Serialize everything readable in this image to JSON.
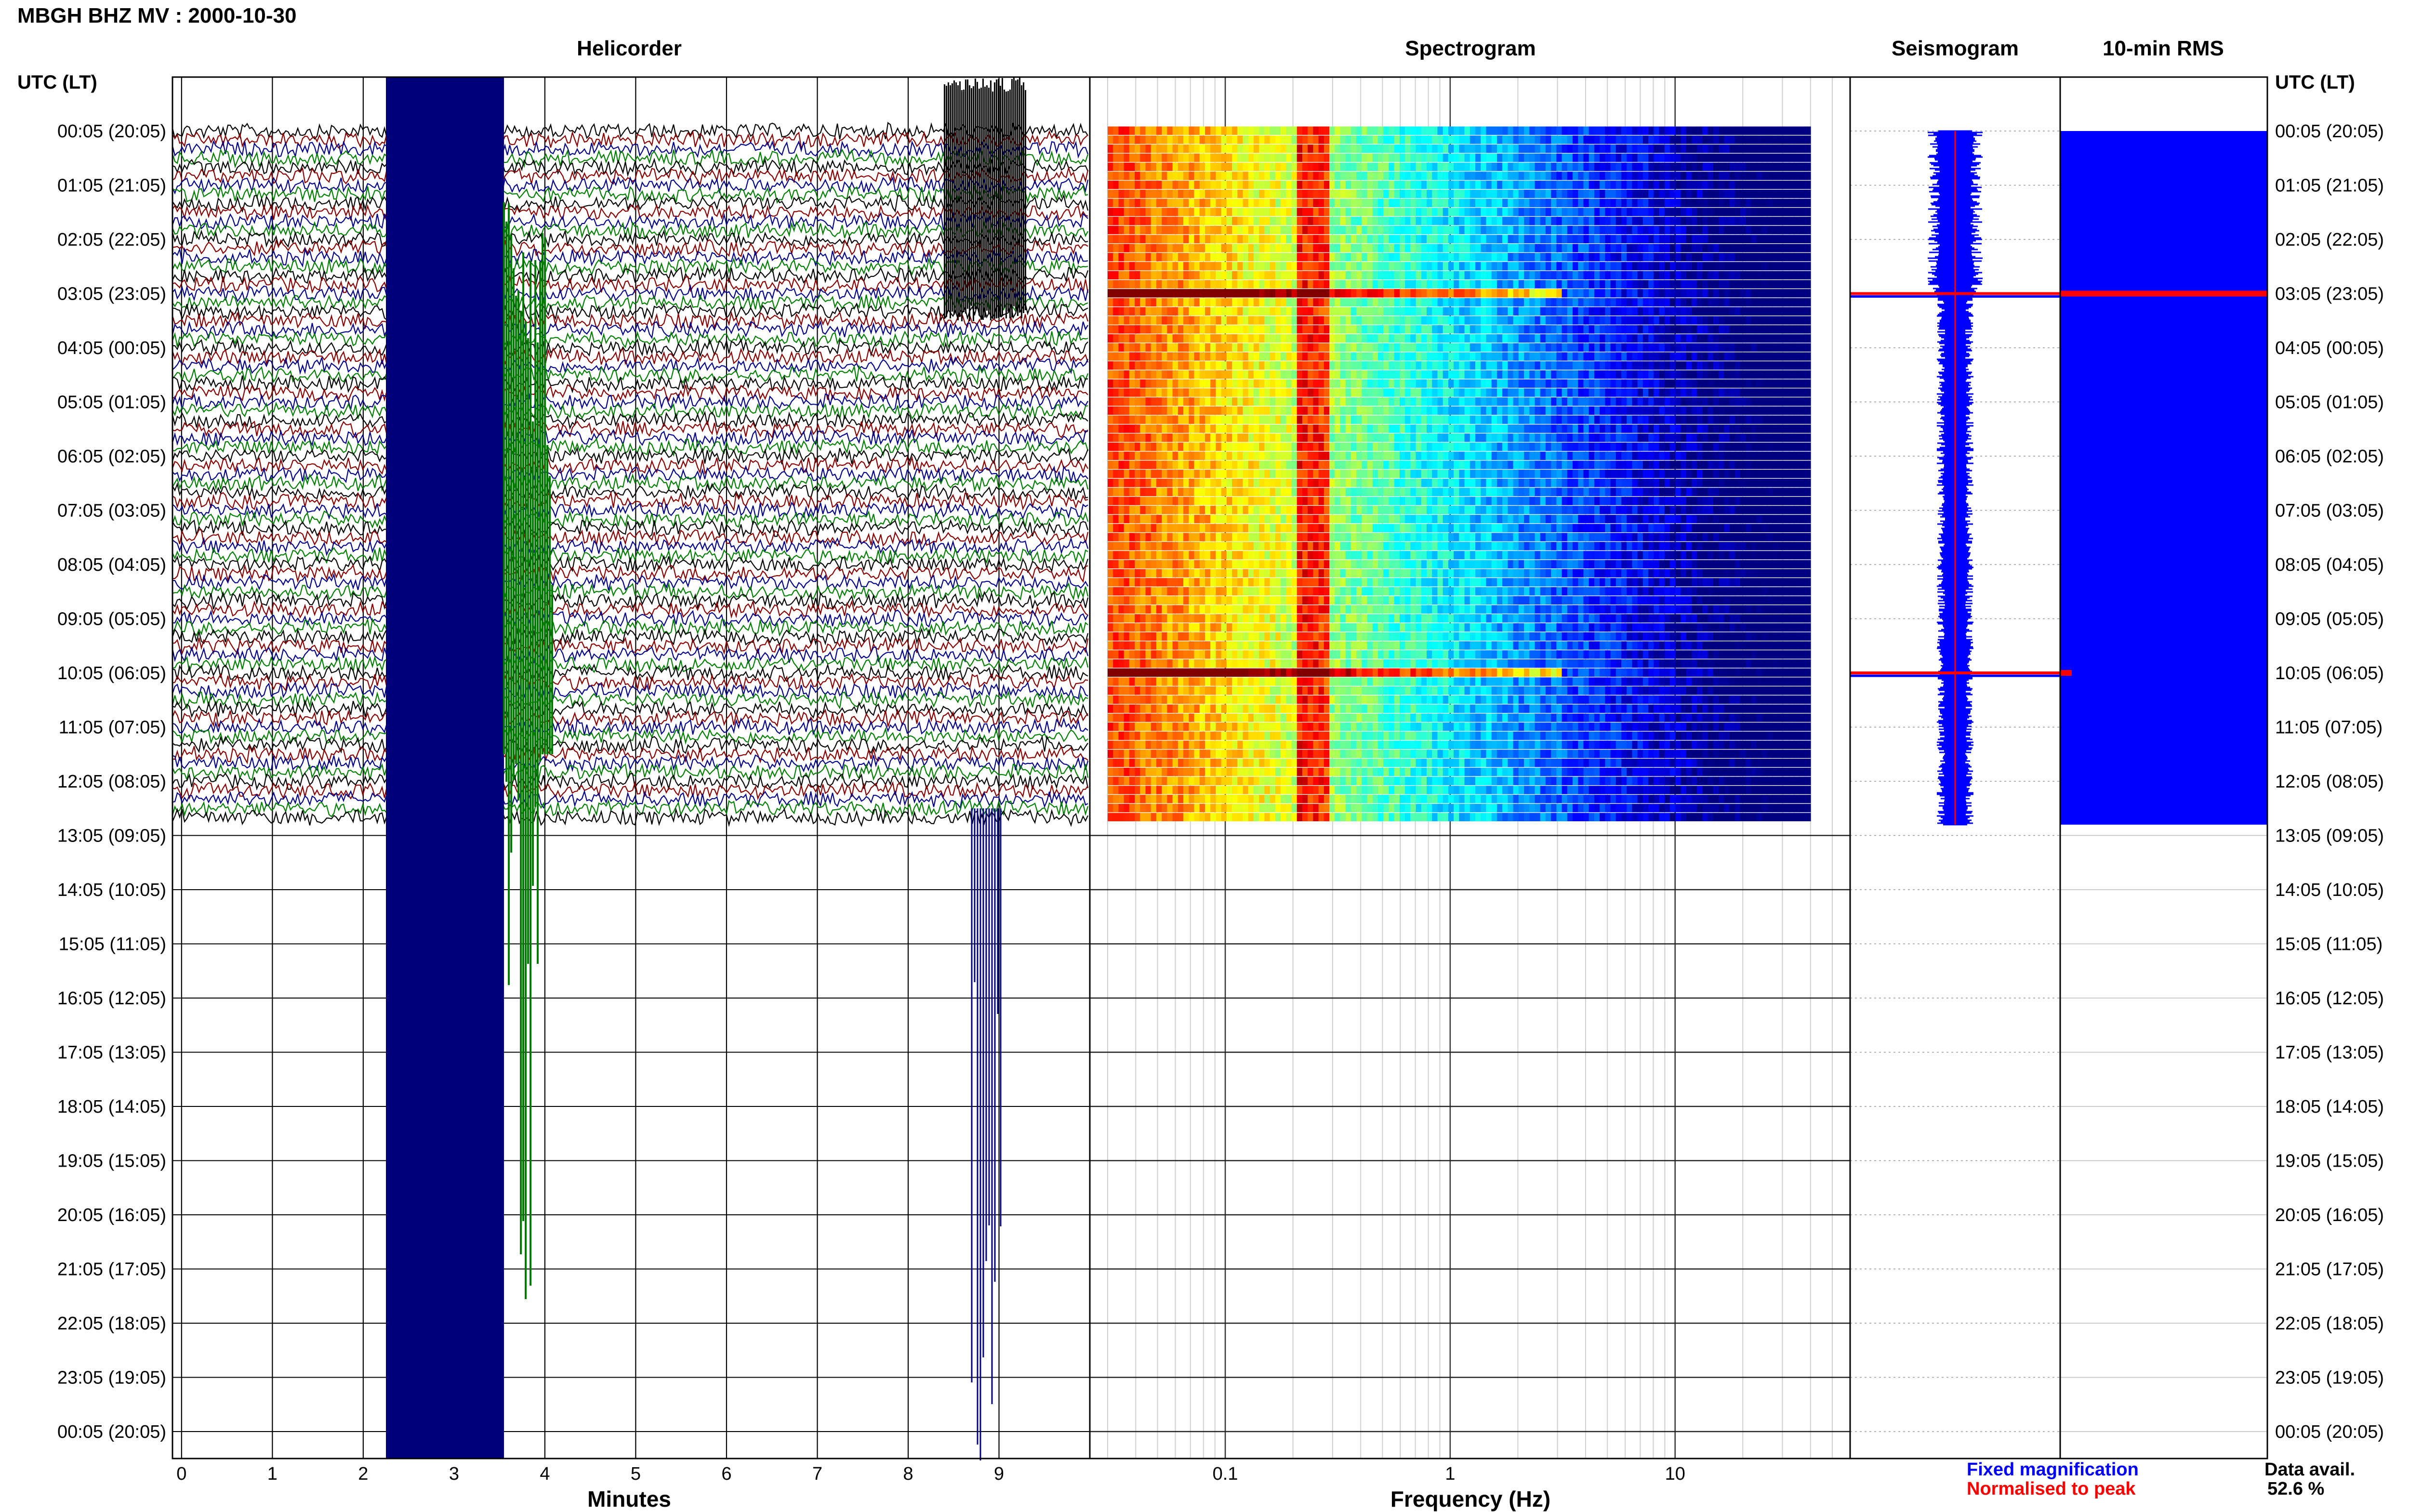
{
  "title": "MBGH BHZ MV : 2000-10-30",
  "utc_label_left": "UTC (LT)",
  "utc_label_right": "UTC (LT)",
  "legend": {
    "fixed": "Fixed magnification",
    "normalised": "Normalised to peak",
    "fixed_color": "#0000ff",
    "normalised_color": "#ff0000"
  },
  "data_availability": {
    "label": "Data avail.",
    "value": "52.6 %"
  },
  "colors": {
    "helicorder_traces": [
      "#000000",
      "#8b0000",
      "#00008b",
      "#008000"
    ],
    "seismogram": "#0000ff",
    "rms": "#0000ff",
    "highlight": "#ff0000"
  },
  "chart_data": [
    {
      "type": "line",
      "title": "Helicorder",
      "xlabel": "Minutes",
      "ylabel": "",
      "xlim": [
        -0.1,
        10
      ],
      "x_ticks": [
        0,
        1,
        2,
        3,
        4,
        5,
        6,
        7,
        8,
        9
      ],
      "y_tick_labels": [
        "00:05 (20:05)",
        "01:05 (21:05)",
        "02:05 (22:05)",
        "03:05 (23:05)",
        "04:05 (00:05)",
        "05:05 (01:05)",
        "06:05 (02:05)",
        "07:05 (03:05)",
        "08:05 (04:05)",
        "09:05 (05:05)",
        "10:05 (06:05)",
        "11:05 (07:05)",
        "12:05 (08:05)",
        "13:05 (09:05)",
        "14:05 (10:05)",
        "15:05 (11:05)",
        "16:05 (12:05)",
        "17:05 (13:05)",
        "18:05 (14:05)",
        "19:05 (15:05)",
        "20:05 (16:05)",
        "21:05 (17:05)",
        "22:05 (18:05)",
        "23:05 (19:05)",
        "00:05 (20:05)"
      ],
      "grid": true,
      "data_hours_utc": [
        0,
        12.8
      ],
      "events": [
        {
          "start_min": 2.25,
          "end_min": 3.55,
          "description": "saturated blue band across all rows"
        },
        {
          "start_min": 3.55,
          "end_min": 4.1,
          "description": "large green event"
        },
        {
          "start_min": 8.4,
          "end_min": 9.3,
          "description": "large event 00:05-03:05"
        }
      ]
    },
    {
      "type": "heatmap",
      "title": "Spectrogram",
      "xlabel": "Frequency (Hz)",
      "x_scale": "log",
      "xlim": [
        0.025,
        60
      ],
      "x_ticks": [
        0.1,
        1,
        10
      ],
      "x_tick_labels": [
        "0.1",
        "1",
        "10"
      ],
      "data_freq_range": [
        0.03,
        40
      ],
      "peak_band_hz": [
        0.2,
        0.28
      ],
      "colormap": "jet",
      "grid": true,
      "strong_rows_utc": [
        "03:05",
        "10:05"
      ]
    },
    {
      "type": "line",
      "title": "Seismogram",
      "xlabel": "",
      "ylabel": "",
      "center_fraction": 0.5,
      "normal_halfwidth_fraction": 0.12,
      "after_0305_halfwidth_fraction": 0.08,
      "spikes_utc": [
        "03:05",
        "10:05"
      ],
      "data_hours_utc": [
        0,
        12.8
      ]
    },
    {
      "type": "bar",
      "title": "10-min RMS",
      "xlabel": "",
      "ylabel": "",
      "fill_fraction": 1.0,
      "peaks_utc": [
        "03:05",
        "10:05"
      ],
      "data_hours_utc": [
        0,
        12.8
      ]
    }
  ]
}
